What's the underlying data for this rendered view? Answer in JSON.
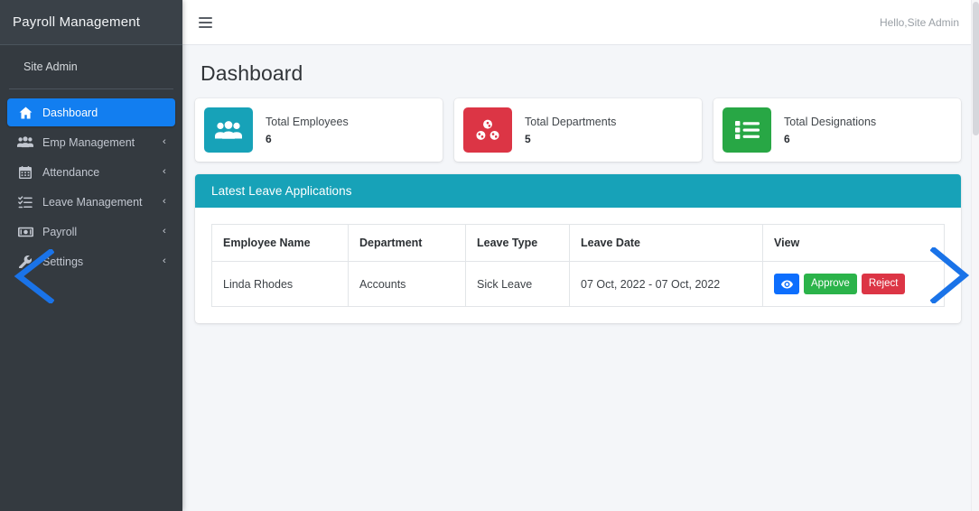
{
  "sidebar": {
    "brand": "Payroll Management",
    "user": "Site Admin",
    "items": [
      {
        "label": "Dashboard",
        "icon": "home-icon",
        "active": true,
        "caret": ""
      },
      {
        "label": "Emp Management",
        "icon": "users-group-icon",
        "active": false,
        "caret": "‹"
      },
      {
        "label": "Attendance",
        "icon": "calendar-icon",
        "active": false,
        "caret": "‹"
      },
      {
        "label": "Leave Management",
        "icon": "list-check-icon",
        "active": false,
        "caret": "‹"
      },
      {
        "label": "Payroll",
        "icon": "money-bill-icon",
        "active": false,
        "caret": "‹"
      },
      {
        "label": "Settings",
        "icon": "wrench-icon",
        "active": false,
        "caret": "‹"
      }
    ]
  },
  "topbar": {
    "menu_icon": "hamburger-icon",
    "greeting": "Hello,Site Admin"
  },
  "page": {
    "title": "Dashboard"
  },
  "cards": [
    {
      "label": "Total Employees",
      "value": "6",
      "icon": "users-group-icon",
      "color": "#17a2b8"
    },
    {
      "label": "Total Departments",
      "value": "5",
      "icon": "sitemap-icon",
      "color": "#dc3545"
    },
    {
      "label": "Total Designations",
      "value": "6",
      "icon": "list-ul-icon",
      "color": "#28a745"
    }
  ],
  "panel": {
    "title": "Latest Leave Applications",
    "header_color": "#17a2b8",
    "table": {
      "columns": [
        "Employee Name",
        "Department",
        "Leave Type",
        "Leave Date",
        "View"
      ],
      "rows": [
        {
          "employee_name": "Linda Rhodes",
          "department": "Accounts",
          "leave_type": "Sick Leave",
          "leave_date": "07 Oct, 2022 - 07 Oct, 2022",
          "actions": {
            "view_icon": "eye-icon",
            "approve_label": "Approve",
            "reject_label": "Reject"
          }
        }
      ]
    }
  },
  "annotations": {
    "arrow_color": "#1a73e8",
    "left_arrow": "chevron-left-arrow",
    "right_arrow": "chevron-right-arrow"
  }
}
